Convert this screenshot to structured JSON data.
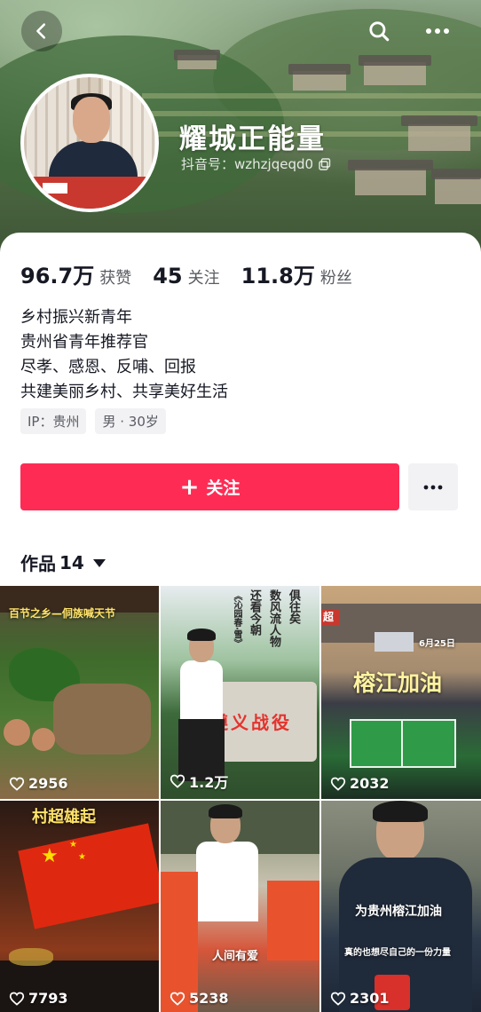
{
  "header": {
    "username": "耀城正能量",
    "douyin_id_label": "抖音号：",
    "douyin_id": "wzhzjqeqd0"
  },
  "stats": [
    {
      "value": "96.7万",
      "label": "获赞"
    },
    {
      "value": "45",
      "label": "关注"
    },
    {
      "value": "11.8万",
      "label": "粉丝"
    }
  ],
  "bio": [
    "乡村振兴新青年",
    "贵州省青年推荐官",
    "尽孝、感恩、反哺、回报",
    "共建美丽乡村、共享美好生活"
  ],
  "tags": [
    "IP：贵州",
    "男 · 30岁"
  ],
  "actions": {
    "follow_label": "关注"
  },
  "works": {
    "label": "作品",
    "count": "14"
  },
  "videos": [
    {
      "likes": "2956",
      "caption": "百节之乡—侗族喊天节"
    },
    {
      "likes": "1.2万",
      "caption": "还看今朝",
      "caption2": "数风流人物",
      "caption3": "俱往矣",
      "caption4": "遵义战役",
      "caption5": "《沁园春·雪》"
    },
    {
      "likes": "2032",
      "caption": "榕江加油",
      "date": "6月25日",
      "sign": "超"
    },
    {
      "likes": "7793",
      "caption": "村超雄起"
    },
    {
      "likes": "5238",
      "caption": "人间有爱"
    },
    {
      "likes": "2301",
      "caption": "为贵州榕江加油",
      "caption2": "真的也想尽自己的一份力量"
    }
  ],
  "colors": {
    "accent": "#fe2c55",
    "text": "#161823",
    "muted": "#5a5c63"
  }
}
